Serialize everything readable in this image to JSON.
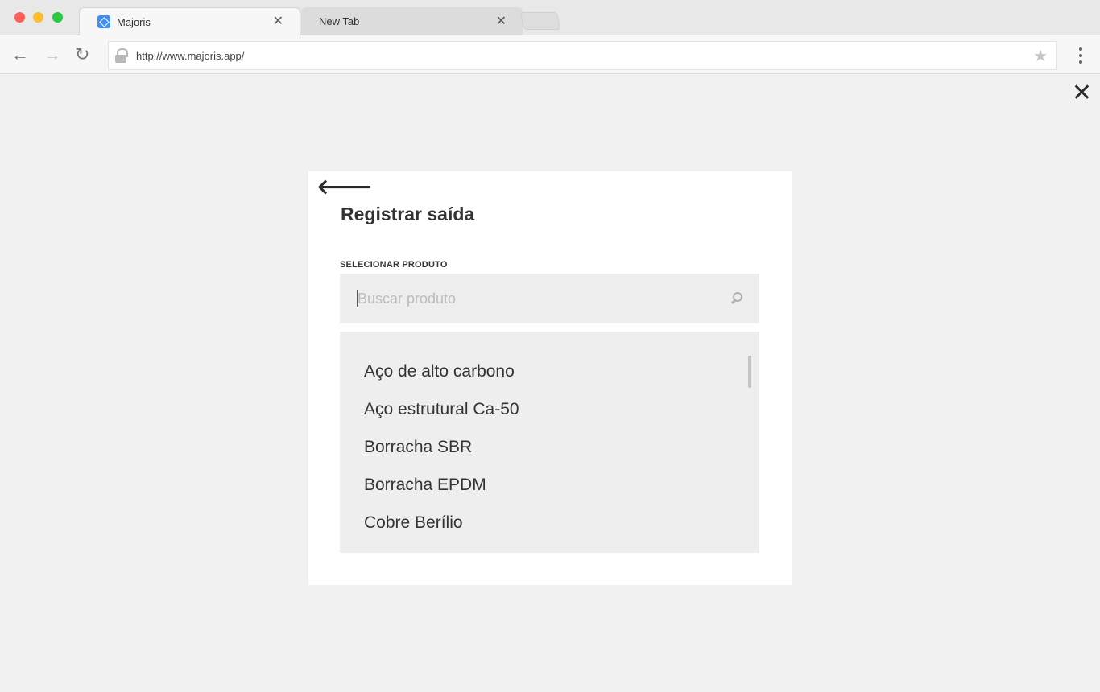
{
  "browser": {
    "tabs": [
      {
        "title": "Majoris",
        "active": true
      },
      {
        "title": "New Tab",
        "active": false
      }
    ],
    "url": "http://www.majoris.app/"
  },
  "modal": {
    "title": "Registrar saída",
    "field_label": "SELECIONAR PRODUTO",
    "search": {
      "placeholder": "Buscar produto",
      "value": ""
    },
    "products": [
      "Aço de alto carbono",
      "Aço estrutural Ca-50",
      "Borracha SBR",
      "Borracha EPDM",
      "Cobre Berílio"
    ]
  },
  "colors": {
    "favicon": "#3f8ef7",
    "background": "#f1f1f1",
    "panel": "#eeeeee"
  },
  "icons": {
    "back": "arrow-left-icon",
    "close": "close-icon",
    "search": "search-icon"
  }
}
